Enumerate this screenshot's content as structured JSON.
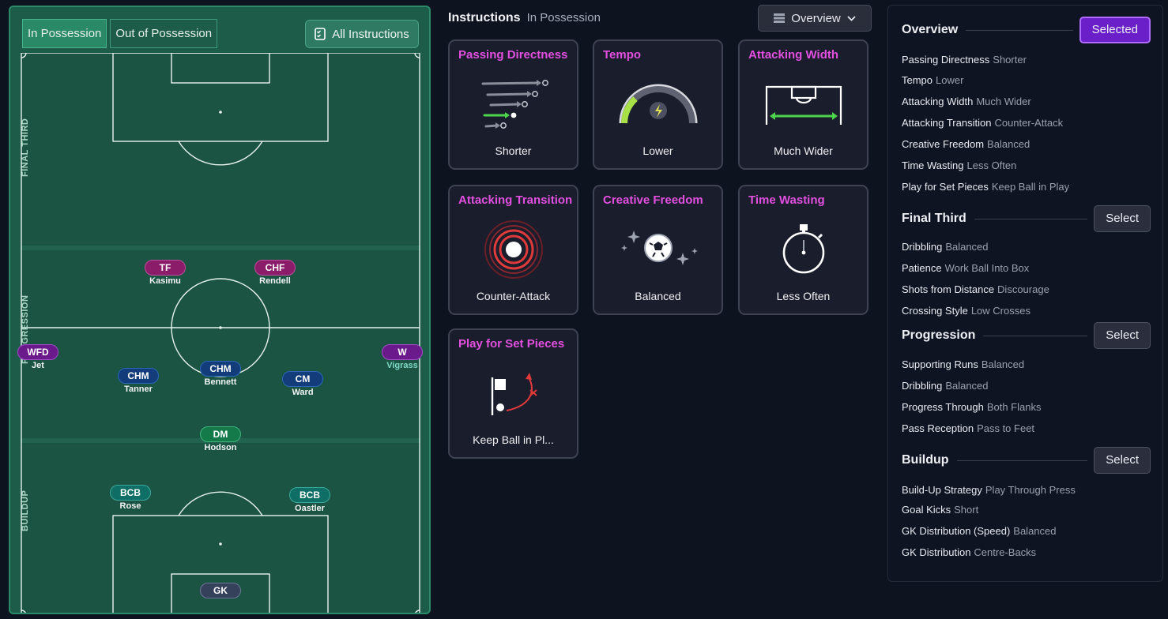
{
  "pitch": {
    "tabs": [
      {
        "label": "In Possession",
        "active": true
      },
      {
        "label": "Out of Possession",
        "active": false
      }
    ],
    "all_instructions_label": "All Instructions",
    "zones": [
      "FINAL THIRD",
      "PROGRESSION",
      "BUILDUP"
    ],
    "players": [
      {
        "pos": "TF",
        "name": "Kasimu",
        "style": "attack"
      },
      {
        "pos": "CHF",
        "name": "Rendell",
        "style": "attack"
      },
      {
        "pos": "WFD",
        "name": "Jet",
        "style": "wide"
      },
      {
        "pos": "W",
        "name": "Vigrass",
        "style": "wide"
      },
      {
        "pos": "CHM",
        "name": "Tanner",
        "style": "mid"
      },
      {
        "pos": "CHM",
        "name": "Bennett",
        "style": "mid"
      },
      {
        "pos": "CM",
        "name": "Ward",
        "style": "mid"
      },
      {
        "pos": "DM",
        "name": "Hodson",
        "style": "dm"
      },
      {
        "pos": "BCB",
        "name": "Rose",
        "style": "back"
      },
      {
        "pos": "BCB",
        "name": "Oastler",
        "style": "back"
      },
      {
        "pos": "GK",
        "name": "",
        "style": "gk"
      }
    ]
  },
  "instructions": {
    "title": "Instructions",
    "subtitle": "In Possession",
    "view_dropdown": {
      "icon": "list-icon",
      "selected": "Overview"
    },
    "cards": [
      {
        "title": "Passing Directness",
        "value": "Shorter",
        "icon": "passing-arrows-icon"
      },
      {
        "title": "Tempo",
        "value": "Lower",
        "icon": "tempo-gauge-icon"
      },
      {
        "title": "Attacking Width",
        "value": "Much Wider",
        "icon": "pitch-width-icon"
      },
      {
        "title": "Attacking Transition",
        "value": "Counter-Attack",
        "icon": "target-rings-icon"
      },
      {
        "title": "Creative Freedom",
        "value": "Balanced",
        "icon": "ball-sparkle-icon"
      },
      {
        "title": "Time Wasting",
        "value": "Less Often",
        "icon": "stopwatch-icon"
      },
      {
        "title": "Play for Set Pieces",
        "value": "Keep Ball in Pl...",
        "icon": "corner-flag-icon"
      }
    ]
  },
  "summary": {
    "sections": [
      {
        "name": "Overview",
        "button": "Selected",
        "selected": true,
        "rows": [
          {
            "k": "Passing Directness",
            "v": "Shorter"
          },
          {
            "k": "Tempo",
            "v": "Lower"
          },
          {
            "k": "Attacking Width",
            "v": "Much Wider"
          },
          {
            "k": "Attacking Transition",
            "v": "Counter-Attack"
          },
          {
            "k": "Creative Freedom",
            "v": "Balanced"
          },
          {
            "k": "Time Wasting",
            "v": "Less Often"
          },
          {
            "k": "Play for Set Pieces",
            "v": "Keep Ball in Play"
          }
        ]
      },
      {
        "name": "Final Third",
        "button": "Select",
        "selected": false,
        "rows": [
          {
            "k": "Dribbling",
            "v": "Balanced"
          },
          {
            "k": "Patience",
            "v": "Work Ball Into Box"
          },
          {
            "k": "Shots from Distance",
            "v": "Discourage"
          },
          {
            "k": "Crossing Style",
            "v": "Low Crosses"
          }
        ]
      },
      {
        "name": "Progression",
        "button": "Select",
        "selected": false,
        "rows": [
          {
            "k": "Supporting Runs",
            "v": "Balanced"
          },
          {
            "k": "Dribbling",
            "v": "Balanced"
          },
          {
            "k": "Progress Through",
            "v": "Both Flanks"
          },
          {
            "k": "Pass Reception",
            "v": "Pass to Feet"
          }
        ]
      },
      {
        "name": "Buildup",
        "button": "Select",
        "selected": false,
        "rows": [
          {
            "k": "Build-Up Strategy",
            "v": "Play Through Press"
          },
          {
            "k": "Goal Kicks",
            "v": "Short"
          },
          {
            "k": "GK Distribution (Speed)",
            "v": "Balanced"
          },
          {
            "k": "GK Distribution",
            "v": "Centre-Backs"
          }
        ]
      }
    ]
  },
  "colors": {
    "accent_purple": "#6a1fc9",
    "card_title": "#e34fe0",
    "pitch_green": "#1b5443"
  }
}
